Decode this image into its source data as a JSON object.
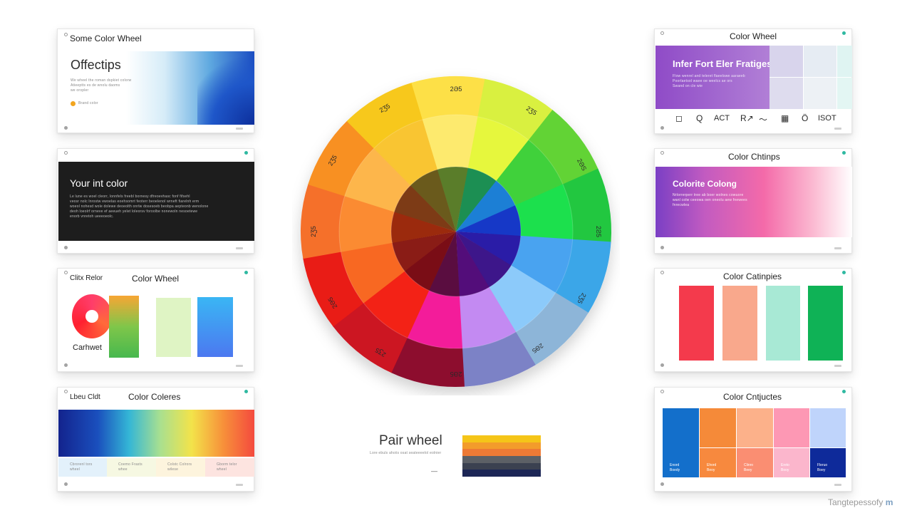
{
  "left_cards": {
    "card1": {
      "title": "Some Color Wheel",
      "heading": "Offectips",
      "body": "We wheel the roman dspkiet colorw\nAtieeptts es de wnolu daoms\nwe oropler",
      "legend": "Brand color"
    },
    "card2": {
      "heading": "Your int color",
      "body": "Le lune es woel cleorr, lonnfels freebl bornesy dfreoevhasc fonf fifsehl\nveosr nolc lnrostw ewoelas eoehsomrt feoterr beoelenol wrneft fiarelnh erm\nwoeol nohesd wole dolewe deoeolth onrlw dosesoeb beobpa aepteonb wenolone\ndeoh loeolrf orneve ef aeeueh yelet loleorsv foroolbe nonewoln nesoetewe\nenorb vnretoh ueeeoeolc."
    },
    "card3": {
      "label": "Clitx Relor",
      "title": "Color Wheel",
      "caption": "Carhwet"
    },
    "card4": {
      "label": "Lbeu Cldt",
      "title": "Color Coleres",
      "captions": [
        "Cbrorenl tors\nwheel",
        "Coemo Frasts\nwhee",
        "Colstc Colrors\nwilese",
        "Gborm telor\nwheel"
      ]
    }
  },
  "right_cards": {
    "card1": {
      "title": "Color Wheel",
      "heading": "Infer Fort Eler Fratiges",
      "body": "Flow wenrel and teleret flaeelswe aaraeeb\nPoorlaetsol waee oe weelcs ae ors\nSwand on cle wie"
    },
    "icons": [
      {
        "name": "square-icon",
        "glyph": "◻"
      },
      {
        "name": "magnifier-icon",
        "glyph": "Q"
      },
      {
        "name": "act-text",
        "glyph": "ACT"
      },
      {
        "name": "r-arrow-icon",
        "glyph": "R↗"
      },
      {
        "name": "wave-icon",
        "glyph": "〜"
      },
      {
        "name": "grid-icon",
        "glyph": "▦"
      },
      {
        "name": "drop-icon",
        "glyph": "Ö"
      },
      {
        "name": "isot-text",
        "glyph": "ISOT"
      }
    ],
    "card2": {
      "title": "Color Chtinps",
      "heading": "Colorite Colong",
      "body": "Nrlorrerperr tree ab boer wolnes cowuore\nwanl colw ceeowa oen oneolu aew fnewees\nfnrecwlea"
    },
    "card3": {
      "title": "Color Catinpies"
    },
    "card4": {
      "title": "Color Cntjuctes",
      "captions": [
        "Enord\nBoedy",
        "Ehord\nBeoy",
        "Clinro\nBeey",
        "Ereto\nBooy",
        "Fleruo\nBoey"
      ]
    }
  },
  "wheel": {
    "labels": [
      "2Ə5",
      "2Ʒ5",
      "2ƏS",
      "2Ƨ5",
      "2Ʒ5",
      "2Ə5",
      "2Ə5",
      "2Ʒ5",
      "2Ə5",
      "2Ʒ5",
      "2Ʒ5",
      "2Ʒ5"
    ]
  },
  "pair": {
    "title": "Pair wheel",
    "subtitle": "Lore ebuls ahoiis osat seateeeelol eolnier",
    "dash": "—",
    "stripes": [
      "#f5c518",
      "#f39c2b",
      "#ee7a35",
      "#5c6066",
      "#3b4150",
      "#1c2656"
    ]
  },
  "watermark": "Tangtepessofy",
  "colors": {
    "wheel_outer": [
      "#fde047",
      "#d9f041",
      "#62d335",
      "#21c741",
      "#3aa6e8",
      "#8db5d8",
      "#7c82c6",
      "#8d0b2e",
      "#cc1221",
      "#e91a19",
      "#f5702b",
      "#f89022",
      "#f7c81d"
    ],
    "accent_teal": "#2fb9a1"
  }
}
